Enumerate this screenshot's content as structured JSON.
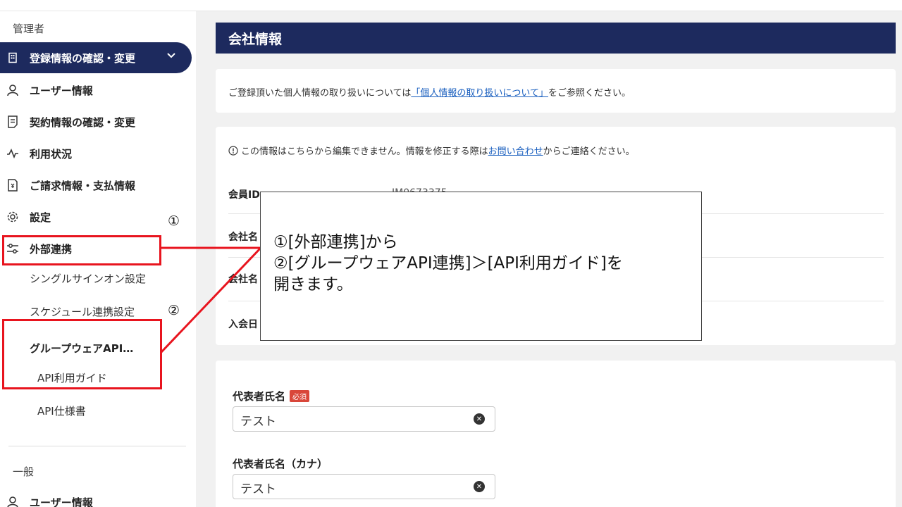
{
  "sidebar": {
    "admin_label": "管理者",
    "items": [
      {
        "label": "登録情報の確認・変更",
        "icon": "building-icon"
      },
      {
        "label": "ユーザー情報",
        "icon": "user-icon"
      },
      {
        "label": "契約情報の確認・変更",
        "icon": "document-icon"
      },
      {
        "label": "利用状況",
        "icon": "activity-icon"
      },
      {
        "label": "ご請求情報・支払情報",
        "icon": "invoice-icon"
      },
      {
        "label": "設定",
        "icon": "gear-icon"
      },
      {
        "label": "外部連携",
        "icon": "integration-icon"
      }
    ],
    "sub_items": {
      "sso": "シングルサインオン設定",
      "schedule": "スケジュール連携設定",
      "groupware": "グループウェアAPI…",
      "api_guide": "API利用ガイド",
      "api_spec": "API仕様書"
    },
    "general_label": "一般",
    "general_items": [
      {
        "label": "ユーザー情報",
        "icon": "user-icon"
      }
    ]
  },
  "main": {
    "title": "会社情報",
    "privacy_notice": {
      "before": "ご登録頂いた個人情報の取り扱いについては",
      "link": "「個人情報の取り扱いについて」",
      "after": "をご参照ください。"
    },
    "edit_notice": {
      "before": "この情報はこちらから編集できません。情報を修正する際は",
      "link": "お問い合わせ",
      "after": "からご連絡ください。"
    },
    "info_rows": [
      {
        "label": "会員ID",
        "value": "JM0673375"
      },
      {
        "label": "会社名",
        "value": ""
      },
      {
        "label": "会社名",
        "value": ""
      },
      {
        "label": "入会日",
        "value": ""
      }
    ],
    "form": {
      "rep_name_label": "代表者氏名",
      "required_badge": "必須",
      "rep_name_value": "テスト",
      "rep_kana_label": "代表者氏名（カナ）",
      "rep_kana_value": "テスト"
    }
  },
  "annotation": {
    "marker1": "①",
    "marker2": "②",
    "callout_lines": [
      "①[外部連携]から",
      "②[グループウェアAPI連携]＞[API利用ガイド]を",
      "開きます。"
    ],
    "highlight_color": "#e8141e"
  }
}
